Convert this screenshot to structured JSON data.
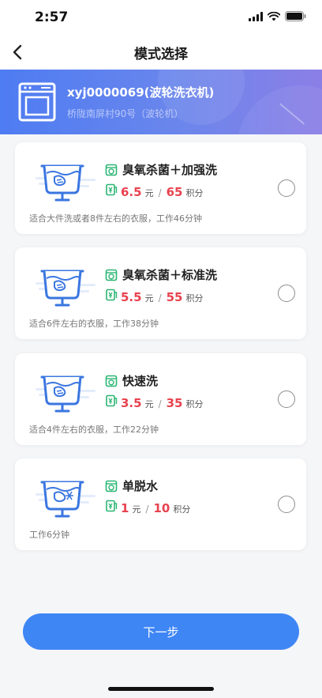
{
  "status": {
    "time": "2:57"
  },
  "nav": {
    "title": "模式选择"
  },
  "device": {
    "name": "xyj0000069(波轮洗衣机)",
    "address": "桥陇南屏村90号（波轮机）"
  },
  "modes": [
    {
      "title": "臭氧杀菌＋加强洗",
      "price": "6.5",
      "price_unit": "元",
      "separator": "/",
      "points": "65",
      "points_unit": "积分",
      "desc": "适合大件洗或者8件左右的衣服，工作46分钟"
    },
    {
      "title": "臭氧杀菌＋标准洗",
      "price": "5.5",
      "price_unit": "元",
      "separator": "/",
      "points": "55",
      "points_unit": "积分",
      "desc": "适合6件左右的衣服，工作38分钟"
    },
    {
      "title": "快速洗",
      "price": "3.5",
      "price_unit": "元",
      "separator": "/",
      "points": "35",
      "points_unit": "积分",
      "desc": "适合4件左右的衣服，工作22分钟"
    },
    {
      "title": "单脱水",
      "price": "1",
      "price_unit": "元",
      "separator": "/",
      "points": "10",
      "points_unit": "积分",
      "desc": "工作6分钟"
    }
  ],
  "footer": {
    "next_label": "下一步"
  },
  "colors": {
    "accent": "#3f86f5",
    "price": "#e8424f",
    "icon_green": "#2bb673",
    "banner_start": "#4e7cf2",
    "banner_end": "#8b7fe6"
  },
  "icons": [
    "back-icon",
    "signal-icon",
    "wifi-icon",
    "battery-icon",
    "washing-machine-icon",
    "wash-basin-icon",
    "mode-icon",
    "price-tag-icon",
    "radio-icon"
  ]
}
